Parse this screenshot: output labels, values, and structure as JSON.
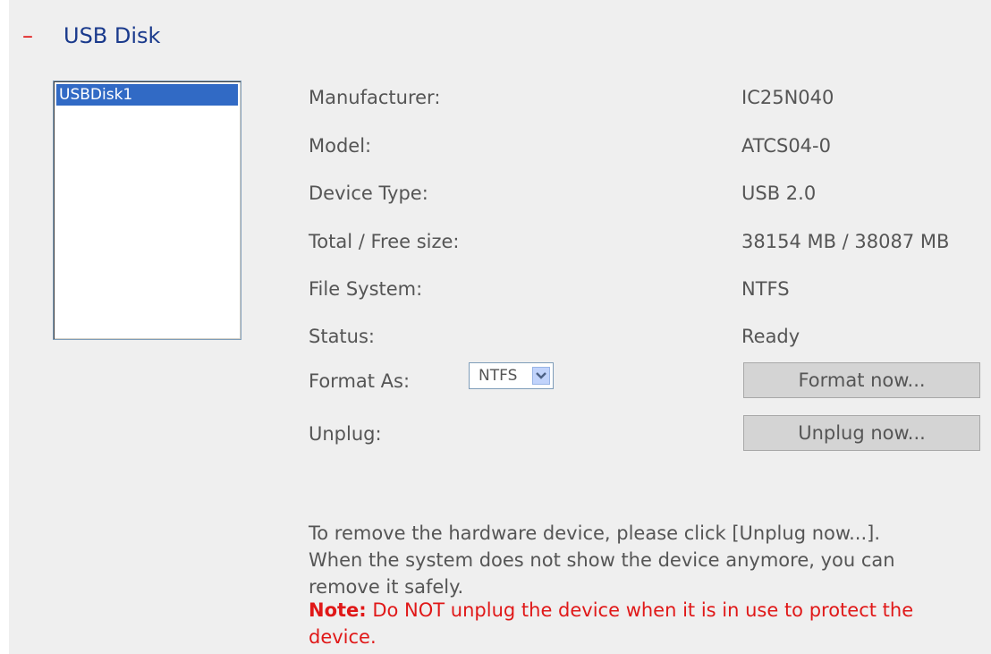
{
  "section": {
    "collapse_symbol": "–",
    "title": "USB Disk"
  },
  "disk_list": {
    "items": [
      "USBDisk1"
    ],
    "selected": "USBDisk1"
  },
  "details": {
    "manufacturer": {
      "label": "Manufacturer:",
      "value": "IC25N040"
    },
    "model": {
      "label": "Model:",
      "value": "ATCS04-0"
    },
    "device_type": {
      "label": "Device Type:",
      "value": "USB 2.0"
    },
    "size": {
      "label": "Total / Free size:",
      "value": "38154 MB / 38087 MB"
    },
    "file_system": {
      "label": "File System:",
      "value": "NTFS"
    },
    "status": {
      "label": "Status:",
      "value": "Ready"
    }
  },
  "format": {
    "label": "Format As:",
    "selected": "NTFS",
    "button_label": "Format now..."
  },
  "unplug": {
    "label": "Unplug:",
    "button_label": "Unplug now..."
  },
  "help": {
    "text": "To remove the hardware device, please click [Unplug now...]. When the system does not show the device anymore, you can remove it safely."
  },
  "note": {
    "label": "Note:",
    "text": " Do NOT unplug the device when it is in use to protect the device."
  },
  "colors": {
    "panel_bg": "#efefef",
    "title_blue": "#1a3a8c",
    "warning_red": "#e01818",
    "selection_blue": "#316ac5",
    "text_gray": "#555555"
  }
}
